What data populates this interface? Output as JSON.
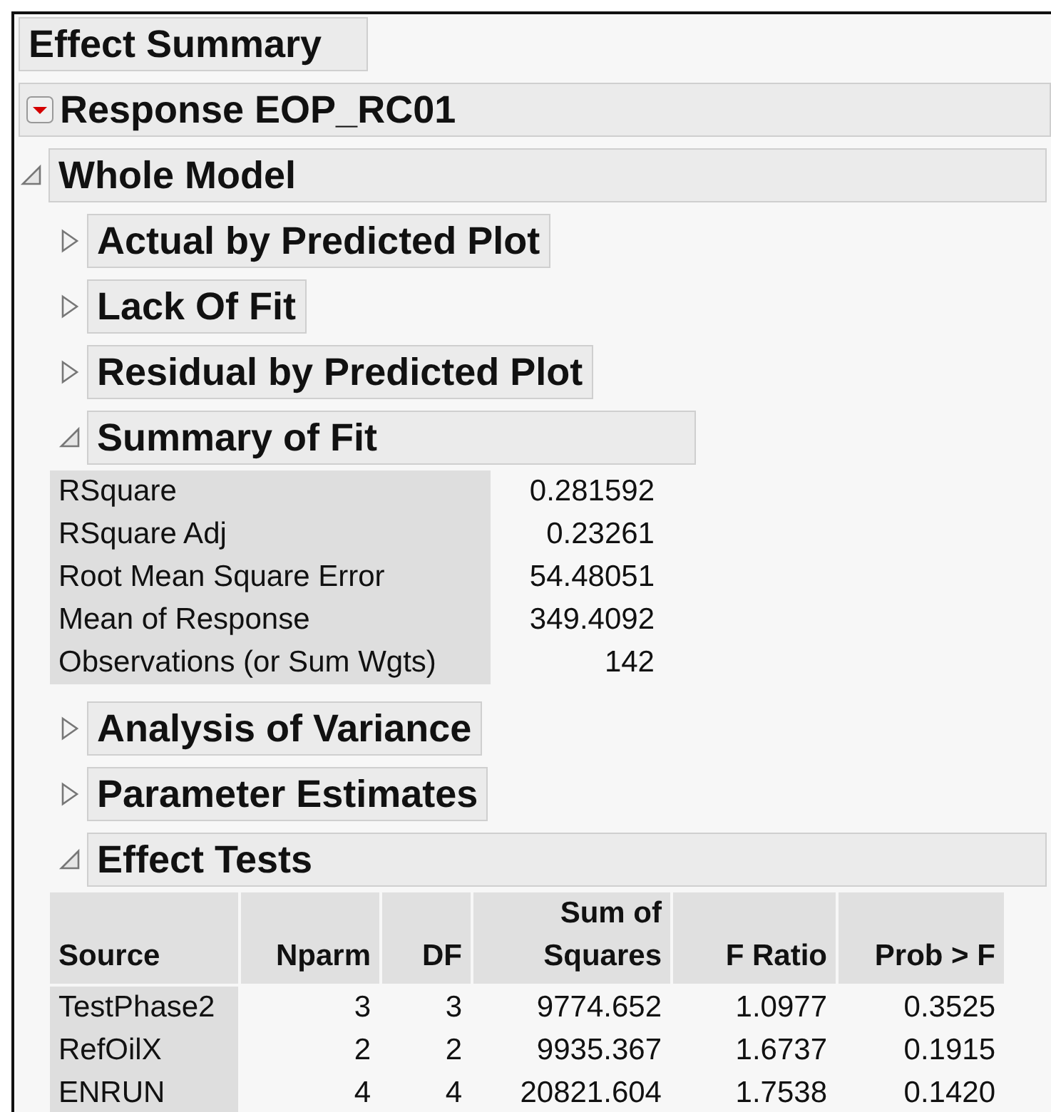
{
  "report_title": "Effect Summary",
  "response": {
    "title": "Response EOP_RC01"
  },
  "whole_model": {
    "title": "Whole Model",
    "expanded": true,
    "sections": [
      {
        "kind": "collapsed",
        "title": "Actual by Predicted Plot",
        "expanded": false
      },
      {
        "kind": "collapsed",
        "title": "Lack Of Fit",
        "expanded": false
      },
      {
        "kind": "collapsed",
        "title": "Residual by Predicted Plot",
        "expanded": false
      },
      {
        "kind": "summary",
        "title": "Summary of Fit",
        "expanded": true,
        "rows": [
          {
            "label": "RSquare",
            "value": "0.281592"
          },
          {
            "label": "RSquare Adj",
            "value": "0.23261"
          },
          {
            "label": "Root Mean Square Error",
            "value": "54.48051"
          },
          {
            "label": "Mean of Response",
            "value": "349.4092"
          },
          {
            "label": "Observations (or Sum Wgts)",
            "value": "142"
          }
        ]
      },
      {
        "kind": "collapsed",
        "title": "Analysis of Variance",
        "expanded": false
      },
      {
        "kind": "collapsed",
        "title": "Parameter Estimates",
        "expanded": false
      },
      {
        "kind": "table",
        "title": "Effect Tests",
        "expanded": true,
        "columns": [
          {
            "lines": [
              "Source"
            ]
          },
          {
            "lines": [
              "Nparm"
            ]
          },
          {
            "lines": [
              "DF"
            ]
          },
          {
            "lines": [
              "Sum of",
              "Squares"
            ]
          },
          {
            "lines": [
              "F Ratio"
            ]
          },
          {
            "lines": [
              "Prob > F"
            ]
          }
        ],
        "rows": [
          [
            "TestPhase2",
            "3",
            "3",
            "9774.652",
            "1.0977",
            "0.3525"
          ],
          [
            "RefOilX",
            "2",
            "2",
            "9935.367",
            "1.6737",
            "0.1915"
          ],
          [
            "ENRUN",
            "4",
            "4",
            "20821.604",
            "1.7538",
            "0.1420"
          ]
        ]
      }
    ]
  }
}
